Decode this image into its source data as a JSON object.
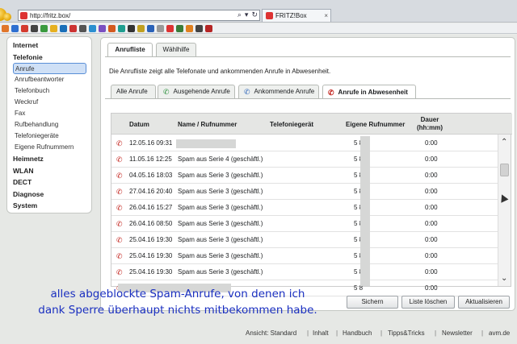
{
  "browser": {
    "url": "http://fritz.box/",
    "tab_title": "FRITZ!Box",
    "tab_close": "×"
  },
  "sidebar": {
    "items": [
      {
        "label": "Internet",
        "level": "h"
      },
      {
        "label": "Telefonie",
        "level": "h"
      },
      {
        "label": "Anrufe",
        "level": "s",
        "active": true
      },
      {
        "label": "Anrufbeantworter",
        "level": "s"
      },
      {
        "label": "Telefonbuch",
        "level": "s"
      },
      {
        "label": "Weckruf",
        "level": "s"
      },
      {
        "label": "Fax",
        "level": "s"
      },
      {
        "label": "Rufbehandlung",
        "level": "s"
      },
      {
        "label": "Telefoniegeräte",
        "level": "s"
      },
      {
        "label": "Eigene Rufnummern",
        "level": "s"
      },
      {
        "label": "Heimnetz",
        "level": "h"
      },
      {
        "label": "WLAN",
        "level": "h"
      },
      {
        "label": "DECT",
        "level": "h"
      },
      {
        "label": "Diagnose",
        "level": "h"
      },
      {
        "label": "System",
        "level": "h"
      }
    ]
  },
  "main": {
    "tabs": [
      "Anrufliste",
      "Wählhilfe"
    ],
    "description": "Die Anrufliste zeigt alle Telefonate und ankommenden Anrufe in Abwesenheit.",
    "subtabs": [
      {
        "label": "Alle Anrufe",
        "icon": ""
      },
      {
        "label": "Ausgehende Anrufe",
        "icon": "outgoing-call-icon"
      },
      {
        "label": "Ankommende Anrufe",
        "icon": "incoming-call-icon"
      },
      {
        "label": "Anrufe in Abwesenheit",
        "icon": "missed-call-icon",
        "active": true
      }
    ],
    "columns": {
      "datum": "Datum",
      "name": "Name / Rufnummer",
      "geraet": "Telefoniegerät",
      "eigene": "Eigene Rufnummer",
      "dauer": "Dauer\n(hh:mm)"
    },
    "rows": [
      {
        "datum": "12.05.16 09:31",
        "name": "",
        "eigene": "5    8",
        "dauer": "0:00"
      },
      {
        "datum": "11.05.16 12:25",
        "name": "Spam aus Serie 4 (geschäftl.)",
        "eigene": "5    8",
        "dauer": "0:00"
      },
      {
        "datum": "04.05.16 18:03",
        "name": "Spam aus Serie 3 (geschäftl.)",
        "eigene": "5    8",
        "dauer": "0:00"
      },
      {
        "datum": "27.04.16 20:40",
        "name": "Spam aus Serie 3 (geschäftl.)",
        "eigene": "5    8",
        "dauer": "0:00"
      },
      {
        "datum": "26.04.16 15:27",
        "name": "Spam aus Serie 3 (geschäftl.)",
        "eigene": "5    8",
        "dauer": "0:00"
      },
      {
        "datum": "26.04.16 08:50",
        "name": "Spam aus Serie 3 (geschäftl.)",
        "eigene": "5    8",
        "dauer": "0:00"
      },
      {
        "datum": "25.04.16 19:30",
        "name": "Spam aus Serie 3 (geschäftl.)",
        "eigene": "5    8",
        "dauer": "0:00"
      },
      {
        "datum": "25.04.16 19:30",
        "name": "Spam aus Serie 3 (geschäftl.)",
        "eigene": "5    8",
        "dauer": "0:00"
      },
      {
        "datum": "25.04.16 19:30",
        "name": "Spam aus Serie 3 (geschäftl.)",
        "eigene": "5    8",
        "dauer": "0:00"
      },
      {
        "datum": "",
        "name": "",
        "eigene": "5    8",
        "dauer": "0:00"
      }
    ],
    "buttons": {
      "sichern": "Sichern",
      "loeschen": "Liste löschen",
      "aktualisieren": "Aktualisieren"
    }
  },
  "footer": {
    "ansicht": "Ansicht: Standard",
    "links": [
      "Inhalt",
      "Handbuch",
      "Tipps&Tricks",
      "Newsletter",
      "avm.de"
    ]
  },
  "caption": {
    "line1": "alles abgeblockte Spam-Anrufe, von denen ich",
    "line2": "dank Sperre überhaupt nichts mitbekommen habe."
  },
  "colors": {
    "caption": "#1a2fc0",
    "missed_call": "#c2231d",
    "active_nav": "#cfe0f6"
  }
}
